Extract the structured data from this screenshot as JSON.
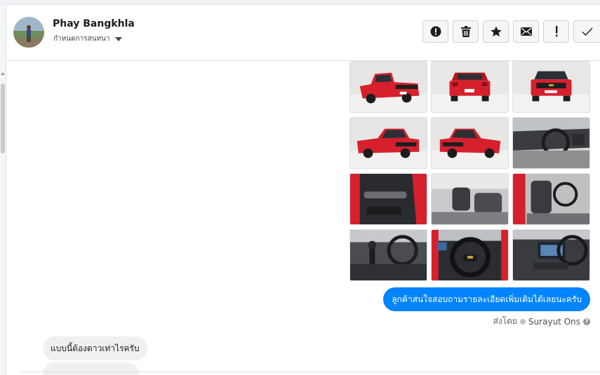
{
  "contact": {
    "name": "Phay Bangkhla",
    "subtitle": "กำหนดการสนทนา"
  },
  "toolbar": {
    "buttons": [
      {
        "icon": "alert-circle-icon"
      },
      {
        "icon": "trash-icon"
      },
      {
        "icon": "star-icon"
      },
      {
        "icon": "envelope-icon"
      },
      {
        "icon": "exclamation-icon"
      },
      {
        "icon": "check-icon"
      }
    ]
  },
  "thread": {
    "photos": [
      {
        "subject": "car-rear-three-quarter"
      },
      {
        "subject": "car-rear"
      },
      {
        "subject": "car-front"
      },
      {
        "subject": "car-front-three-quarter-left"
      },
      {
        "subject": "car-front-three-quarter-right"
      },
      {
        "subject": "interior-dashboard"
      },
      {
        "subject": "door-panel"
      },
      {
        "subject": "interior-seats-rear"
      },
      {
        "subject": "interior-seats-front"
      },
      {
        "subject": "gear-shift"
      },
      {
        "subject": "steering-wheel"
      },
      {
        "subject": "infotainment-screen"
      }
    ],
    "outgoing_message": "ลูกค้าสนใจสอบถามรายละเอียดเพิ่มเติมได้เลยนะครับ",
    "sent_by_label": "ส่งโดย",
    "sent_by_name": "Surayut Ons",
    "incoming_message": "แบบนี้ต้องดาวเท่าไรครับ"
  },
  "colors": {
    "accent": "#0084ff",
    "car_red": "#d6202c",
    "incoming_bg": "#f1f0f0"
  }
}
